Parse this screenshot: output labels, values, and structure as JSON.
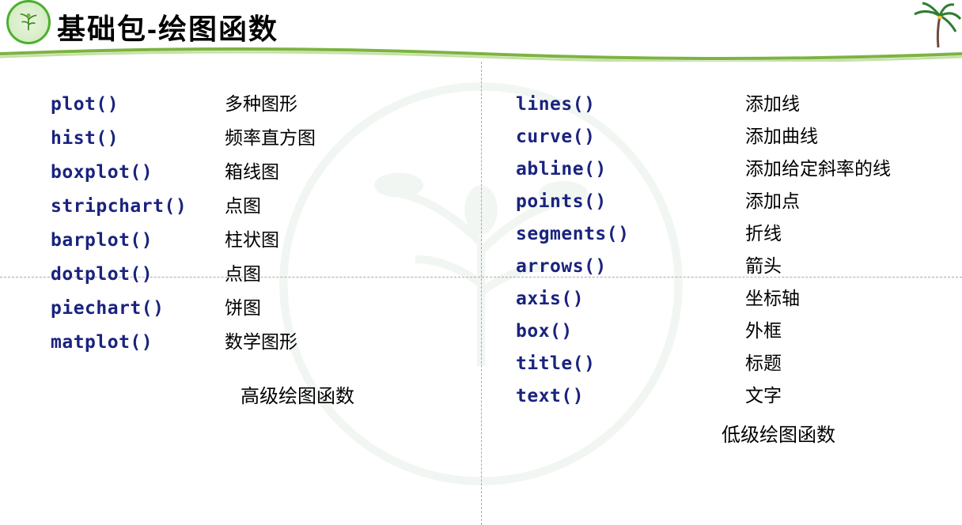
{
  "title": "基础包-绘图函数",
  "left": {
    "caption": "高级绘图函数",
    "items": [
      {
        "fn": "plot()",
        "desc": "多种图形"
      },
      {
        "fn": "hist()",
        "desc": "频率直方图"
      },
      {
        "fn": "boxplot()",
        "desc": "箱线图"
      },
      {
        "fn": "stripchart()",
        "desc": "点图"
      },
      {
        "fn": "barplot()",
        "desc": "柱状图"
      },
      {
        "fn": "dotplot()",
        "desc": "点图"
      },
      {
        "fn": "piechart()",
        "desc": "饼图"
      },
      {
        "fn": "matplot()",
        "desc": "数学图形"
      }
    ]
  },
  "right": {
    "caption": "低级绘图函数",
    "items": [
      {
        "fn": "lines()",
        "desc": "添加线"
      },
      {
        "fn": "curve()",
        "desc": "添加曲线"
      },
      {
        "fn": "abline()",
        "desc": "添加给定斜率的线"
      },
      {
        "fn": "points()",
        "desc": "添加点"
      },
      {
        "fn": "segments()",
        "desc": "折线"
      },
      {
        "fn": "arrows()",
        "desc": "箭头"
      },
      {
        "fn": "axis()",
        "desc": "坐标轴"
      },
      {
        "fn": "box()",
        "desc": "外框"
      },
      {
        "fn": "title()",
        "desc": "标题"
      },
      {
        "fn": "text()",
        "desc": "文字"
      }
    ]
  }
}
